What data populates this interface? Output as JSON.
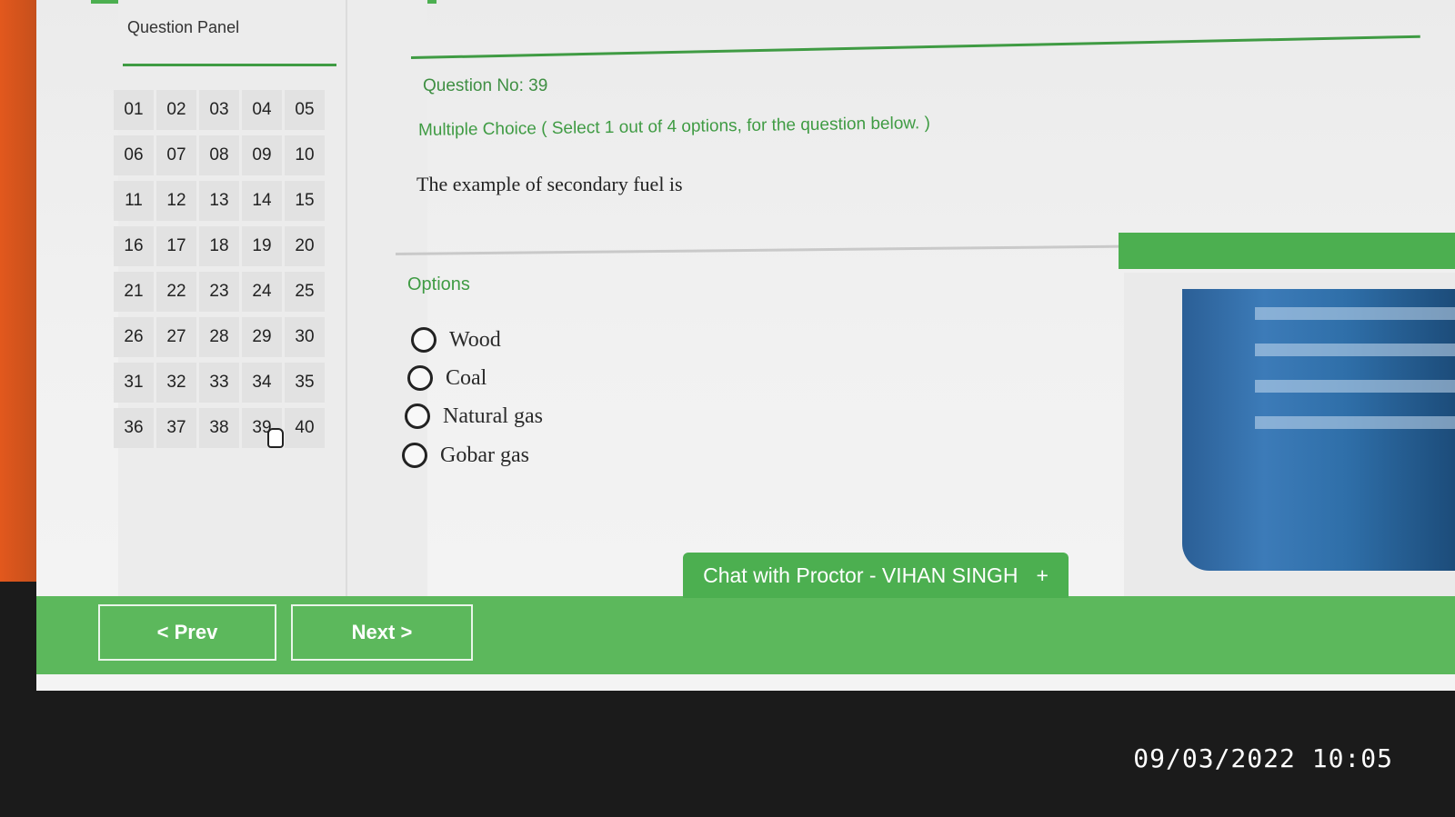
{
  "panel": {
    "title": "Question Panel",
    "numbers": [
      "01",
      "02",
      "03",
      "04",
      "05",
      "06",
      "07",
      "08",
      "09",
      "10",
      "11",
      "12",
      "13",
      "14",
      "15",
      "16",
      "17",
      "18",
      "19",
      "20",
      "21",
      "22",
      "23",
      "24",
      "25",
      "26",
      "27",
      "28",
      "29",
      "30",
      "31",
      "32",
      "33",
      "34",
      "35",
      "36",
      "37",
      "38",
      "39",
      "40"
    ]
  },
  "question": {
    "number_label": "Question No: 39",
    "type_label": "Multiple Choice ( Select 1 out of 4 options, for the question below. )",
    "text": "The example of secondary fuel is"
  },
  "options": {
    "label": "Options",
    "items": [
      "Wood",
      "Coal",
      "Natural gas",
      "Gobar gas"
    ]
  },
  "chat": {
    "label": "Chat with Proctor - VIHAN SINGH",
    "expand_symbol": "+"
  },
  "nav": {
    "prev_label": "< Prev",
    "next_label": "Next >"
  },
  "timestamp": "09/03/2022 10:05",
  "colors": {
    "accent_green": "#4caf50",
    "text_green": "#3f9b43"
  }
}
